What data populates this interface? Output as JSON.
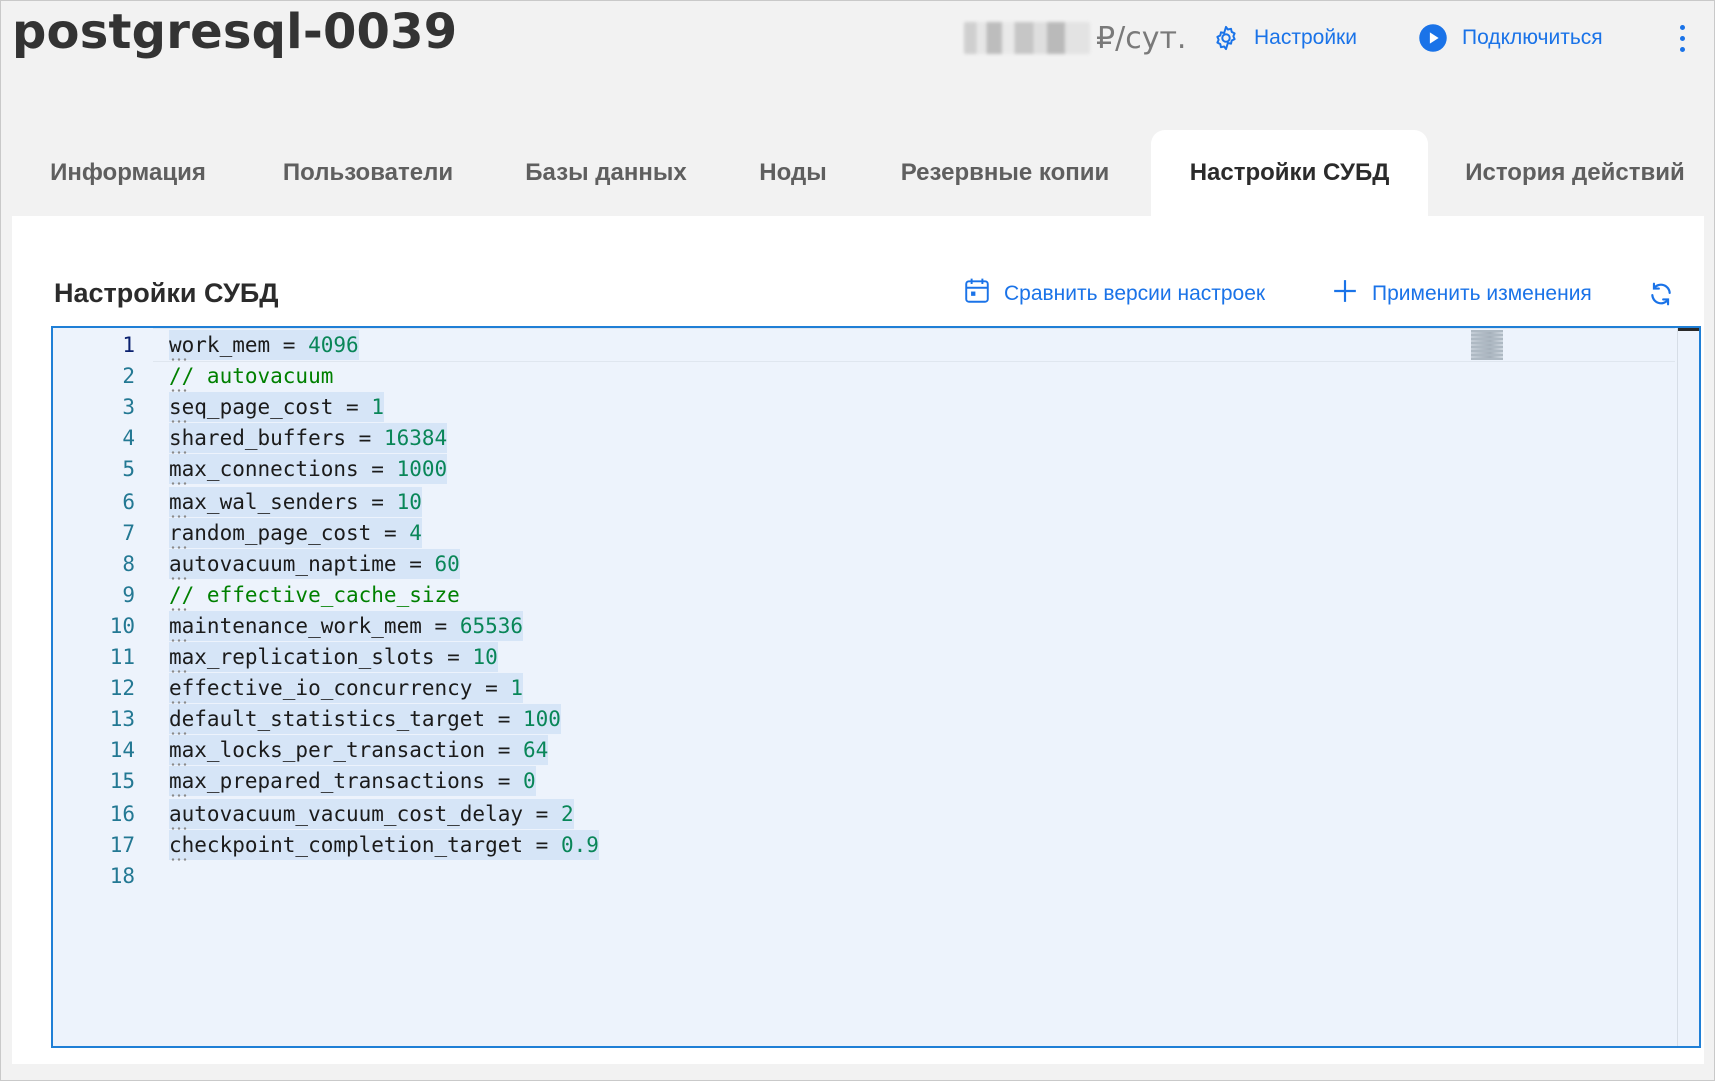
{
  "header": {
    "title": "postgresql-0039",
    "price_unit": "₽/сут.",
    "settings_label": "Настройки",
    "connect_label": "Подключиться"
  },
  "tabs": [
    {
      "label": "Информация",
      "active": false
    },
    {
      "label": "Пользователи",
      "active": false
    },
    {
      "label": "Базы данных",
      "active": false
    },
    {
      "label": "Ноды",
      "active": false
    },
    {
      "label": "Резервные копии",
      "active": false
    },
    {
      "label": "Настройки СУБД",
      "active": true
    },
    {
      "label": "История действий",
      "active": false
    }
  ],
  "section": {
    "title": "Настройки СУБД",
    "compare_label": "Сравнить версии настроек",
    "apply_label": "Применить изменения"
  },
  "editor": {
    "lines": [
      {
        "n": "1",
        "key": "work_mem",
        "op": " = ",
        "val": "4096"
      },
      {
        "n": "2",
        "comment": "// autovacuum"
      },
      {
        "n": "3",
        "key": "seq_page_cost",
        "op": " = ",
        "val": "1"
      },
      {
        "n": "4",
        "key": "shared_buffers",
        "op": " = ",
        "val": "16384"
      },
      {
        "n": "5",
        "key": "max_connections",
        "op": " = ",
        "val": "1000"
      },
      {
        "n": "6",
        "key": "max_wal_senders",
        "op": " = ",
        "val": "10"
      },
      {
        "n": "7",
        "key": "random_page_cost",
        "op": " = ",
        "val": "4"
      },
      {
        "n": "8",
        "key": "autovacuum_naptime",
        "op": " = ",
        "val": "60"
      },
      {
        "n": "9",
        "comment": "// effective_cache_size"
      },
      {
        "n": "10",
        "key": "maintenance_work_mem",
        "op": " = ",
        "val": "65536"
      },
      {
        "n": "11",
        "key": "max_replication_slots",
        "op": " = ",
        "val": "10"
      },
      {
        "n": "12",
        "key": "effective_io_concurrency",
        "op": " = ",
        "val": "1"
      },
      {
        "n": "13",
        "key": "default_statistics_target",
        "op": " = ",
        "val": "100"
      },
      {
        "n": "14",
        "key": "max_locks_per_transaction",
        "op": " = ",
        "val": "64"
      },
      {
        "n": "15",
        "key": "max_prepared_transactions",
        "op": " = ",
        "val": "0"
      },
      {
        "n": "16",
        "key": "autovacuum_vacuum_cost_delay",
        "op": " = ",
        "val": "2"
      },
      {
        "n": "17",
        "key": "checkpoint_completion_target",
        "op": " = ",
        "val": "0.9"
      },
      {
        "n": "18"
      }
    ]
  },
  "colors": {
    "accent": "#1a73e8",
    "editor_border": "#1f7fd6",
    "editor_bg": "#edf3fc",
    "number": "#098658",
    "comment": "#008000",
    "line_number": "#237893"
  }
}
